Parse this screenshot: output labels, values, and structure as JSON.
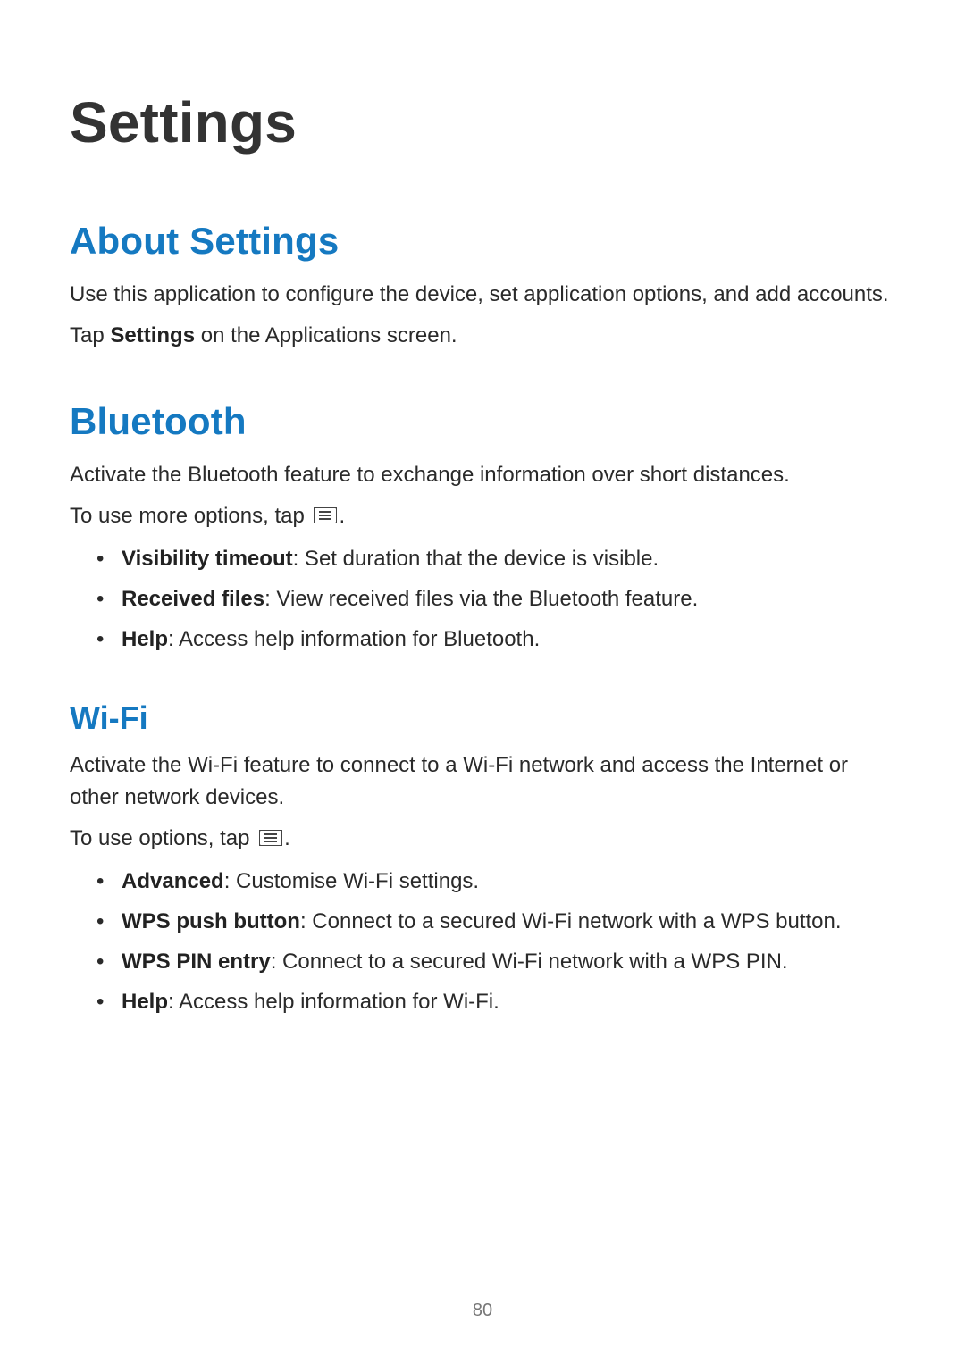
{
  "page": {
    "title": "Settings",
    "number": "80"
  },
  "about": {
    "heading": "About Settings",
    "p1": "Use this application to configure the device, set application options, and add accounts.",
    "p2_pre": "Tap ",
    "p2_bold": "Settings",
    "p2_post": " on the Applications screen."
  },
  "bluetooth": {
    "heading": "Bluetooth",
    "p1": "Activate the Bluetooth feature to exchange information over short distances.",
    "p2_pre": "To use more options, tap ",
    "p2_post": ".",
    "items": [
      {
        "label": "Visibility timeout",
        "desc": ": Set duration that the device is visible."
      },
      {
        "label": "Received files",
        "desc": ": View received files via the Bluetooth feature."
      },
      {
        "label": "Help",
        "desc": ": Access help information for Bluetooth."
      }
    ]
  },
  "wifi": {
    "heading": "Wi-Fi",
    "p1": "Activate the Wi-Fi feature to connect to a Wi-Fi network and access the Internet or other network devices.",
    "p2_pre": "To use options, tap ",
    "p2_post": ".",
    "items": [
      {
        "label": "Advanced",
        "desc": ": Customise Wi-Fi settings."
      },
      {
        "label": "WPS push button",
        "desc": ": Connect to a secured Wi-Fi network with a WPS button."
      },
      {
        "label": "WPS PIN entry",
        "desc": ": Connect to a secured Wi-Fi network with a WPS PIN."
      },
      {
        "label": "Help",
        "desc": ": Access help information for Wi-Fi."
      }
    ]
  },
  "icons": {
    "menu": "menu-icon"
  }
}
